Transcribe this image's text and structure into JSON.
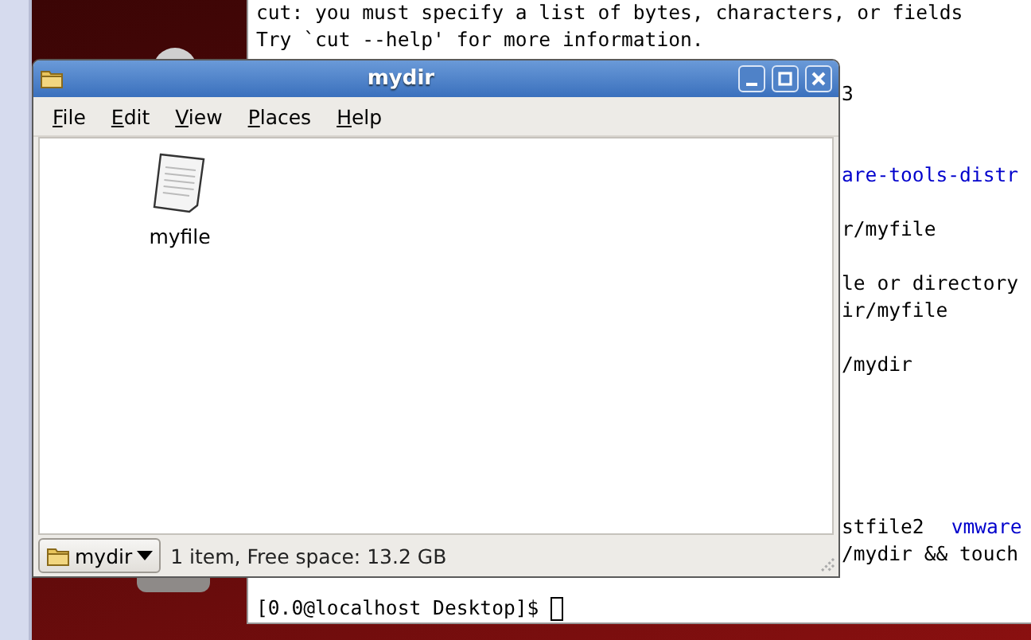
{
  "terminal": {
    "lines": [
      {
        "kind": "full",
        "segments": [
          {
            "text": "cut: you must specify a list of bytes, characters, or fields",
            "color": "#000000"
          }
        ]
      },
      {
        "kind": "full",
        "segments": [
          {
            "text": "Try `cut --help' for more information.",
            "color": "#000000"
          }
        ]
      },
      {
        "kind": "blank"
      },
      {
        "kind": "tail",
        "segments": [
          {
            "text": "3",
            "color": "#000000"
          }
        ]
      },
      {
        "kind": "blank"
      },
      {
        "kind": "blank"
      },
      {
        "kind": "tail",
        "segments": [
          {
            "text": "are-tools-distr",
            "color": "#0000cc"
          }
        ]
      },
      {
        "kind": "blank"
      },
      {
        "kind": "tail",
        "segments": [
          {
            "text": "r/myfile",
            "color": "#000000"
          }
        ]
      },
      {
        "kind": "blank"
      },
      {
        "kind": "tail",
        "segments": [
          {
            "text": "le or directory",
            "color": "#000000"
          }
        ]
      },
      {
        "kind": "tail",
        "segments": [
          {
            "text": "ir/myfile",
            "color": "#000000"
          }
        ]
      },
      {
        "kind": "blank"
      },
      {
        "kind": "tail",
        "segments": [
          {
            "text": "/mydir",
            "color": "#000000"
          }
        ]
      },
      {
        "kind": "blank"
      },
      {
        "kind": "blank"
      },
      {
        "kind": "blank"
      },
      {
        "kind": "blank"
      },
      {
        "kind": "blank"
      },
      {
        "kind": "tail",
        "segments": [
          {
            "text": "stfile2",
            "color": "#000000"
          },
          {
            "text": "vmware",
            "color": "#0000cc"
          }
        ]
      },
      {
        "kind": "tail",
        "segments": [
          {
            "text": "/mydir && touch",
            "color": "#000000"
          }
        ]
      },
      {
        "kind": "blank"
      },
      {
        "kind": "prompt",
        "segments": [
          {
            "text": "[0.0@localhost Desktop]$",
            "color": "#000000"
          }
        ]
      }
    ]
  },
  "window": {
    "title": "mydir",
    "menu": [
      "File",
      "Edit",
      "View",
      "Places",
      "Help"
    ],
    "files": [
      {
        "name": "myfile",
        "kind": "text"
      }
    ],
    "status_bar": {
      "location": "mydir",
      "info": "1 item, Free space: 13.2 GB"
    }
  }
}
